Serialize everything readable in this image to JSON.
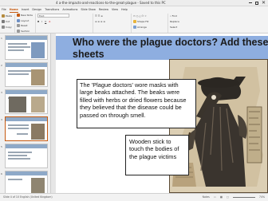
{
  "window": {
    "title": "4 a-the-impacts-and-reactions-to-the-great-plague - Saved to this PC"
  },
  "ribbon": {
    "tabs": [
      "File",
      "Home",
      "Insert",
      "Design",
      "Transitions",
      "Animations",
      "Slide Show",
      "Review",
      "View",
      "Help"
    ],
    "active_tab": "Home",
    "commands": [
      "Paste",
      "Cut",
      "Copy",
      "New Slide",
      "Layout",
      "Reset",
      "Section",
      "Font",
      "Shape Fill",
      "Arrange",
      "Find",
      "Replace",
      "Select"
    ]
  },
  "thumbnails": {
    "numbers": [
      "1",
      "2",
      "3",
      "4",
      "5",
      "6",
      "7"
    ]
  },
  "slide": {
    "title": "Who were the plague doctors? Add these annota... sheets",
    "title_line1": "Who were the plague doctors? Add these annota",
    "title_line2": "sheets",
    "box1_text": "The 'Plague doctors' wore masks with large beaks attached. The beaks were filled with herbs or dried flowers because they believed that the disease could be passed on through smell.",
    "box2_text": "Wooden stick to touch the bodies of the plague victims"
  },
  "status": {
    "left": "Slide 4 of 10   English (United Kingdom)",
    "notes": "Notes",
    "zoom": "74%"
  },
  "colors": {
    "title_band": "#8eaee0",
    "accent": "#c55a11"
  }
}
